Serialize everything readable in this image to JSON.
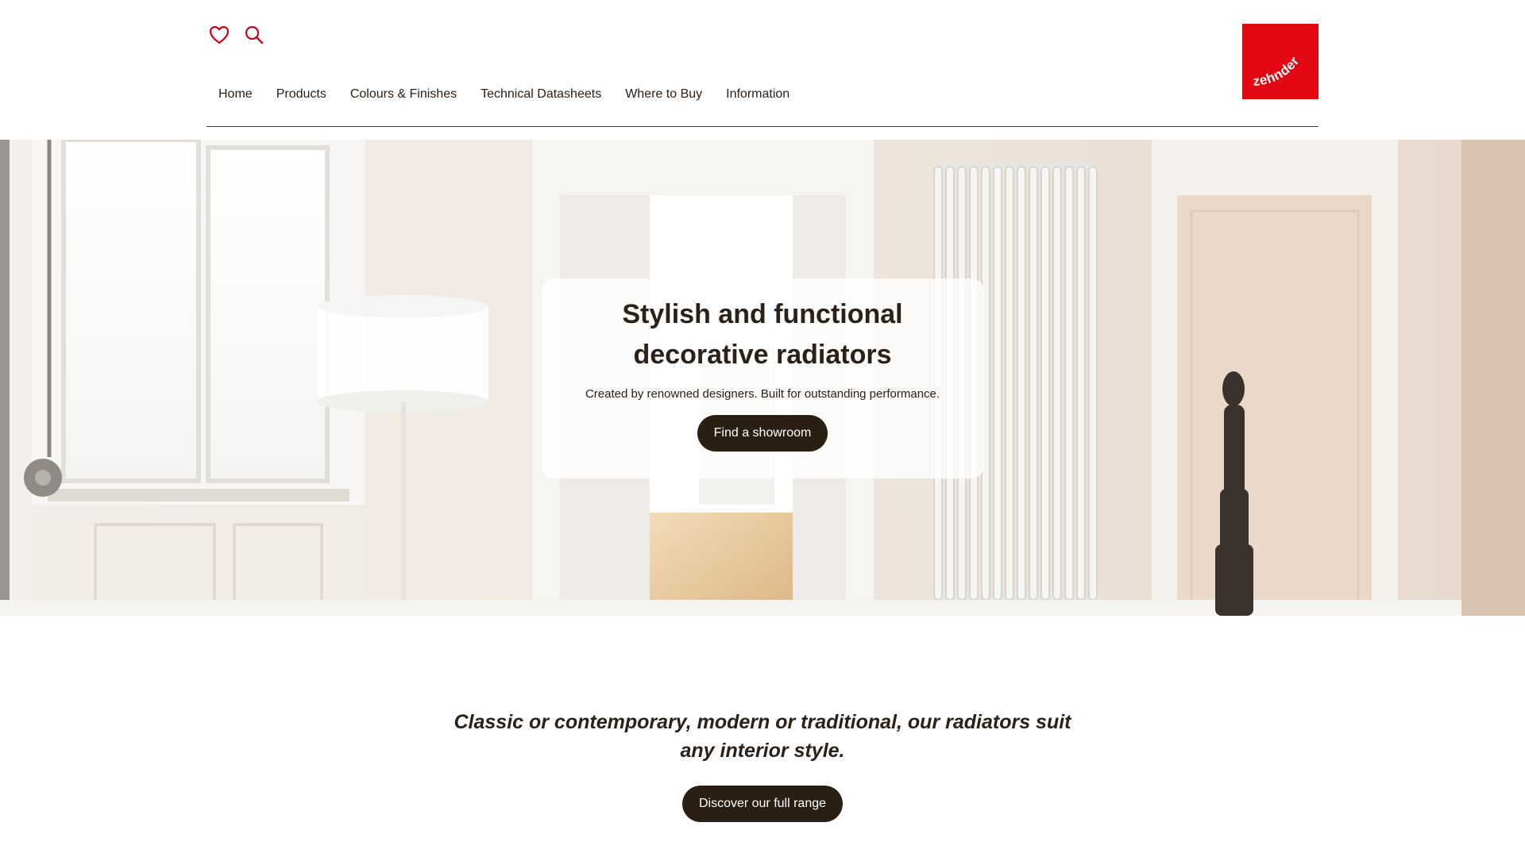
{
  "header": {
    "icons": [
      "heart-icon",
      "search-icon"
    ],
    "nav": [
      {
        "label": "Home"
      },
      {
        "label": "Products"
      },
      {
        "label": "Colours & Finishes"
      },
      {
        "label": "Technical Datasheets"
      },
      {
        "label": "Where to Buy"
      },
      {
        "label": "Information"
      }
    ],
    "logo_text": "zehnder"
  },
  "hero": {
    "title": "Stylish and functional decorative radiators",
    "subtitle": "Created by renowned designers. Built for outstanding performance.",
    "cta_label": "Find a showroom"
  },
  "intro": {
    "text": "Classic or contemporary, modern or traditional, our radiators suit any interior style.",
    "cta_label": "Discover our full range"
  },
  "colors": {
    "brand_red": "#e30613",
    "button_dark": "#2b1f14",
    "text_dark": "#2b2118"
  }
}
